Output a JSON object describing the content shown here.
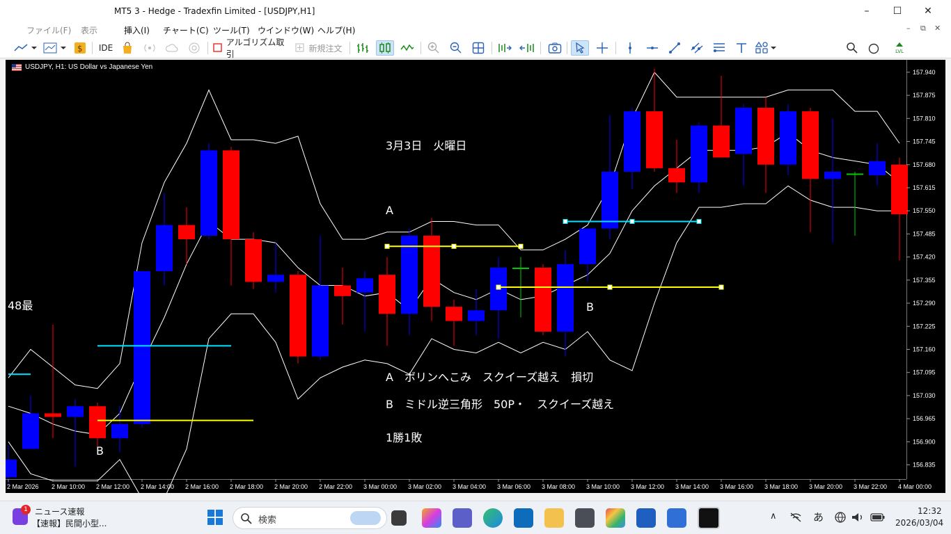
{
  "window": {
    "title": "MT5 3 - Hedge - Tradexfin Limited - [USDJPY,H1]",
    "minimize": "–",
    "maximize": "☐",
    "close": "✕"
  },
  "menu": {
    "items": [
      "ファイル(F)",
      "表示",
      "挿入(I)",
      "チャート(C)",
      "ツール(T)",
      "ウインドウ(W)",
      "ヘルプ(H)"
    ]
  },
  "toolbar": {
    "ide": "IDE",
    "algo_trading": "アルゴリズム取引",
    "new_order": "新規注文",
    "notification_count": "1",
    "signal_level": "LVL"
  },
  "chart": {
    "symbol_title": "USDJPY, H1:  US Dollar vs Japanese Yen",
    "left_edge_label": "48最",
    "annotations": {
      "date": "3月3日　火曜日",
      "label_a": "A",
      "label_b_mid": "B",
      "label_b_left": "B",
      "note_a": "A　ボリンへこみ　スクイーズ越え　損切",
      "note_b": "B　ミドル逆三角形　50P・　スクイーズ越え",
      "result": "1勝1敗"
    }
  },
  "chart_data": {
    "type": "candlestick",
    "title": "USDJPY, H1:  US Dollar vs Japanese Yen",
    "y_ticks": [
      "157.940",
      "157.875",
      "157.810",
      "157.745",
      "157.680",
      "157.615",
      "157.550",
      "157.485",
      "157.420",
      "157.355",
      "157.290",
      "157.225",
      "157.160",
      "157.095",
      "157.030",
      "156.965",
      "156.900",
      "156.835"
    ],
    "x_ticks": [
      "2 Mar 2026",
      "2 Mar 10:00",
      "2 Mar 12:00",
      "2 Mar 14:00",
      "2 Mar 16:00",
      "2 Mar 18:00",
      "2 Mar 20:00",
      "2 Mar 22:00",
      "3 Mar 00:00",
      "3 Mar 02:00",
      "3 Mar 04:00",
      "3 Mar 06:00",
      "3 Mar 08:00",
      "3 Mar 10:00",
      "3 Mar 12:00",
      "3 Mar 14:00",
      "3 Mar 16:00",
      "3 Mar 18:00",
      "3 Mar 20:00",
      "3 Mar 22:00",
      "4 Mar 00:00"
    ],
    "ylim": [
      156.795,
      157.975
    ],
    "colors": {
      "up": "#0000ff",
      "down": "#ff0000",
      "doji": "#00cc00",
      "bands": "#ffffff",
      "line_yellow": "#ffff00",
      "line_cyan": "#00e5ff"
    },
    "candles": [
      {
        "o": 156.8,
        "h": 156.89,
        "l": 156.78,
        "c": 156.85
      },
      {
        "o": 156.88,
        "h": 157.03,
        "l": 156.88,
        "c": 156.98
      },
      {
        "o": 156.98,
        "h": 157.23,
        "l": 156.91,
        "c": 156.97
      },
      {
        "o": 156.97,
        "h": 157.02,
        "l": 156.83,
        "c": 157.0
      },
      {
        "o": 157.0,
        "h": 157.01,
        "l": 156.88,
        "c": 156.91
      },
      {
        "o": 156.91,
        "h": 157.0,
        "l": 156.87,
        "c": 156.95
      },
      {
        "o": 156.95,
        "h": 157.38,
        "l": 156.94,
        "c": 157.38
      },
      {
        "o": 157.38,
        "h": 157.6,
        "l": 157.34,
        "c": 157.51
      },
      {
        "o": 157.51,
        "h": 157.56,
        "l": 157.4,
        "c": 157.47
      },
      {
        "o": 157.48,
        "h": 157.74,
        "l": 157.47,
        "c": 157.72
      },
      {
        "o": 157.72,
        "h": 157.73,
        "l": 157.34,
        "c": 157.47
      },
      {
        "o": 157.47,
        "h": 157.49,
        "l": 157.33,
        "c": 157.35
      },
      {
        "o": 157.35,
        "h": 157.46,
        "l": 157.32,
        "c": 157.37
      },
      {
        "o": 157.37,
        "h": 157.38,
        "l": 157.12,
        "c": 157.14
      },
      {
        "o": 157.14,
        "h": 157.48,
        "l": 157.13,
        "c": 157.34
      },
      {
        "o": 157.34,
        "h": 157.39,
        "l": 157.23,
        "c": 157.31
      },
      {
        "o": 157.32,
        "h": 157.38,
        "l": 157.21,
        "c": 157.36
      },
      {
        "o": 157.37,
        "h": 157.42,
        "l": 157.17,
        "c": 157.26
      },
      {
        "o": 157.26,
        "h": 157.5,
        "l": 157.2,
        "c": 157.48
      },
      {
        "o": 157.48,
        "h": 157.53,
        "l": 157.24,
        "c": 157.28
      },
      {
        "o": 157.28,
        "h": 157.3,
        "l": 157.17,
        "c": 157.24
      },
      {
        "o": 157.24,
        "h": 157.33,
        "l": 157.2,
        "c": 157.27
      },
      {
        "o": 157.27,
        "h": 157.42,
        "l": 157.19,
        "c": 157.39
      },
      {
        "o": 157.39,
        "h": 157.42,
        "l": 157.25,
        "c": 157.39
      },
      {
        "o": 157.39,
        "h": 157.4,
        "l": 157.2,
        "c": 157.21
      },
      {
        "o": 157.21,
        "h": 157.44,
        "l": 157.14,
        "c": 157.4
      },
      {
        "o": 157.4,
        "h": 157.5,
        "l": 157.35,
        "c": 157.5
      },
      {
        "o": 157.5,
        "h": 157.82,
        "l": 157.47,
        "c": 157.66
      },
      {
        "o": 157.66,
        "h": 157.84,
        "l": 157.61,
        "c": 157.83
      },
      {
        "o": 157.83,
        "h": 157.95,
        "l": 157.66,
        "c": 157.67
      },
      {
        "o": 157.67,
        "h": 157.75,
        "l": 157.6,
        "c": 157.63
      },
      {
        "o": 157.63,
        "h": 157.8,
        "l": 157.6,
        "c": 157.79
      },
      {
        "o": 157.79,
        "h": 157.93,
        "l": 157.7,
        "c": 157.7
      },
      {
        "o": 157.71,
        "h": 157.85,
        "l": 157.62,
        "c": 157.84
      },
      {
        "o": 157.84,
        "h": 157.87,
        "l": 157.6,
        "c": 157.68
      },
      {
        "o": 157.68,
        "h": 157.85,
        "l": 157.65,
        "c": 157.83
      },
      {
        "o": 157.83,
        "h": 157.84,
        "l": 157.49,
        "c": 157.64
      },
      {
        "o": 157.64,
        "h": 157.81,
        "l": 157.46,
        "c": 157.66
      },
      {
        "o": 157.655,
        "h": 157.66,
        "l": 157.48,
        "c": 157.655
      },
      {
        "o": 157.65,
        "h": 157.74,
        "l": 157.62,
        "c": 157.69
      },
      {
        "o": 157.68,
        "h": 157.7,
        "l": 157.41,
        "c": 157.54
      }
    ],
    "bands": {
      "upper": [
        157.08,
        157.16,
        157.11,
        157.06,
        157.05,
        157.12,
        157.46,
        157.63,
        157.74,
        157.89,
        157.75,
        157.75,
        157.74,
        157.76,
        157.57,
        157.47,
        157.47,
        157.49,
        157.49,
        157.52,
        157.52,
        157.51,
        157.51,
        157.44,
        157.44,
        157.47,
        157.51,
        157.62,
        157.81,
        157.94,
        157.87,
        157.87,
        157.87,
        157.87,
        157.87,
        157.89,
        157.89,
        157.89,
        157.83,
        157.83,
        157.74
      ],
      "middle": [
        157.0,
        156.98,
        156.95,
        156.93,
        156.92,
        156.98,
        157.12,
        157.25,
        157.4,
        157.52,
        157.47,
        157.47,
        157.46,
        157.39,
        157.34,
        157.34,
        157.31,
        157.32,
        157.27,
        157.36,
        157.32,
        157.3,
        157.33,
        157.3,
        157.31,
        157.34,
        157.37,
        157.43,
        157.55,
        157.62,
        157.67,
        157.72,
        157.72,
        157.72,
        157.73,
        157.77,
        157.72,
        157.7,
        157.69,
        157.68,
        157.63
      ],
      "lower": [
        156.9,
        156.81,
        156.79,
        156.79,
        156.79,
        156.85,
        156.74,
        156.74,
        156.88,
        157.19,
        157.26,
        157.26,
        157.18,
        157.02,
        157.08,
        157.11,
        157.13,
        157.12,
        157.09,
        157.19,
        157.16,
        157.15,
        157.18,
        157.15,
        157.18,
        157.16,
        157.21,
        157.13,
        157.1,
        157.29,
        157.46,
        157.56,
        157.56,
        157.57,
        157.57,
        157.62,
        157.58,
        157.56,
        157.56,
        157.55,
        157.55
      ]
    },
    "hlines": [
      {
        "color": "yellow",
        "price": 156.96,
        "from": 4,
        "to": 11
      },
      {
        "color": "cyan",
        "price": 157.17,
        "from": 4,
        "to": 10
      },
      {
        "color": "cyan",
        "price": 157.09,
        "from": 0,
        "to": 1
      },
      {
        "color": "yellow",
        "price": 157.45,
        "from": 17,
        "to": 23,
        "anchors": true
      },
      {
        "color": "yellow",
        "price": 157.335,
        "from": 22,
        "to": 32,
        "anchors": true
      },
      {
        "color": "cyan",
        "price": 157.52,
        "from": 25,
        "to": 31,
        "anchors": true
      }
    ]
  },
  "taskbar": {
    "news_badge": "1",
    "news_title": "ニュース速報",
    "news_sub": "【速報】民間小型...",
    "search_placeholder": "検索",
    "ime": "あ",
    "time": "12:32",
    "date": "2026/03/04"
  }
}
